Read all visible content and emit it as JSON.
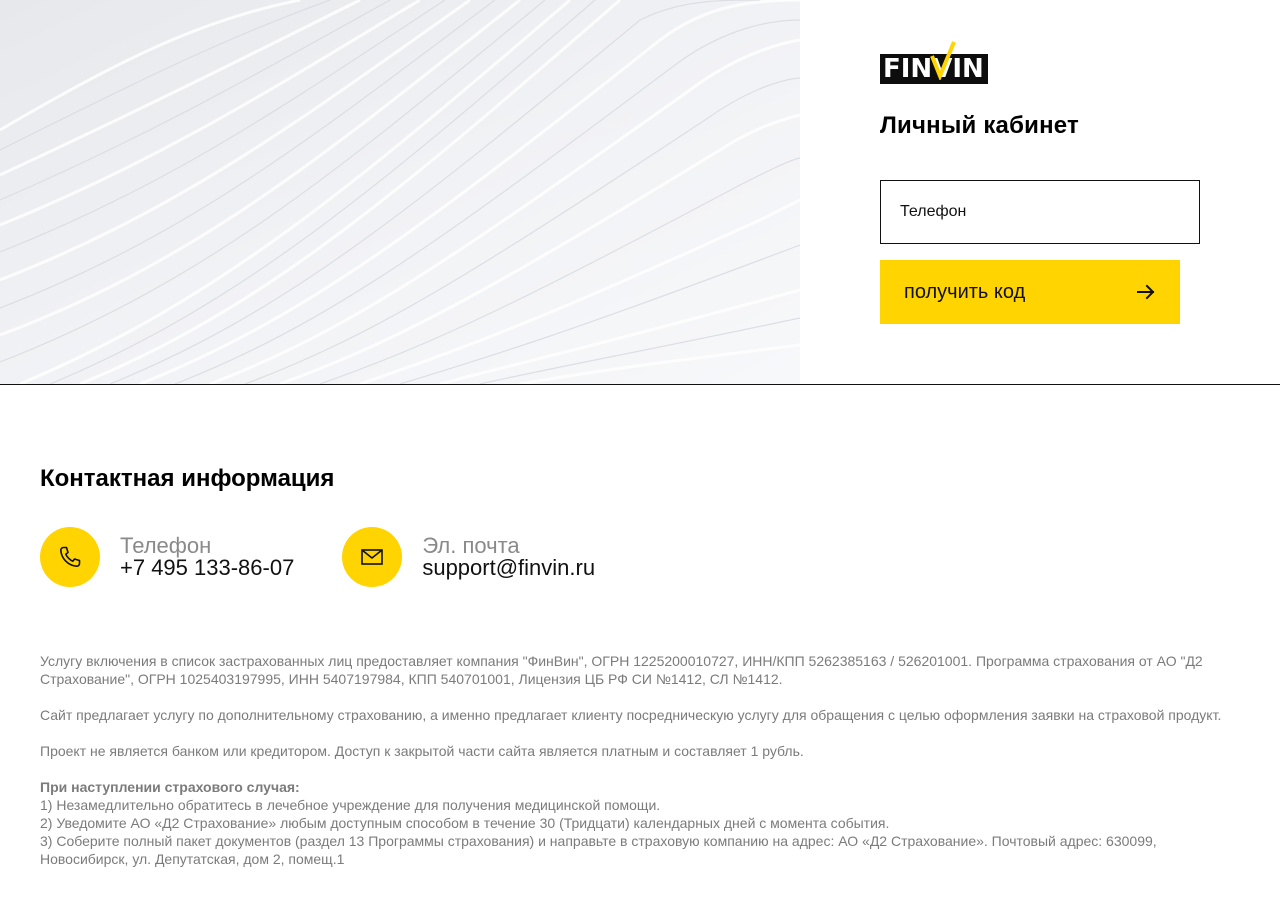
{
  "brand": {
    "logo_text": "FINVIN",
    "accent_color": "#ffd400",
    "dark_color": "#0d0d0d"
  },
  "login": {
    "title": "Личный кабинет",
    "phone_placeholder": "Телефон",
    "phone_value": "",
    "submit_label": "получить код",
    "submit_icon": "arrow-right-icon"
  },
  "contacts": {
    "title": "Контактная информация",
    "items": [
      {
        "icon": "phone-icon",
        "label": "Телефон",
        "value": "+7 495 133-86-07"
      },
      {
        "icon": "mail-icon",
        "label": "Эл. почта",
        "value": "support@finvin.ru"
      }
    ]
  },
  "legal": {
    "paragraph_1": "Услугу включения в список застрахованных лиц предоставляет компания \"ФинВин\", ОГРН 1225200010727, ИНН/КПП 5262385163 / 526201001. Программа страхования от АО \"Д2 Страхование\", ОГРН 1025403197995, ИНН 5407197984, КПП 540701001, Лицензия ЦБ РФ СИ №1412, СЛ №1412.",
    "paragraph_2": "Сайт предлагает услугу по дополнительному страхованию, а именно предлагает клиенту посредническую услугу для обращения с целью оформления заявки на страховой продукт.",
    "paragraph_3": "Проект не является банком или кредитором. Доступ к закрытой части сайта является платным и составляет 1 рубль.",
    "steps_title": "При наступлении страхового случая:",
    "steps": [
      "1) Незамедлительно обратитесь в лечебное учреждение для получения медицинской помощи.",
      "2) Уведомите АО «Д2 Страхование» любым доступным способом в течение 30 (Тридцати) календарных дней с момента события.",
      "3) Соберите полный пакет документов (раздел 13 Программы страхования) и направьте в страховую компанию на адрес: АО «Д2 Страхование». Почтовый адрес: 630099, Новосибирск, ул. Депутатская, дом 2, помещ.1"
    ]
  }
}
